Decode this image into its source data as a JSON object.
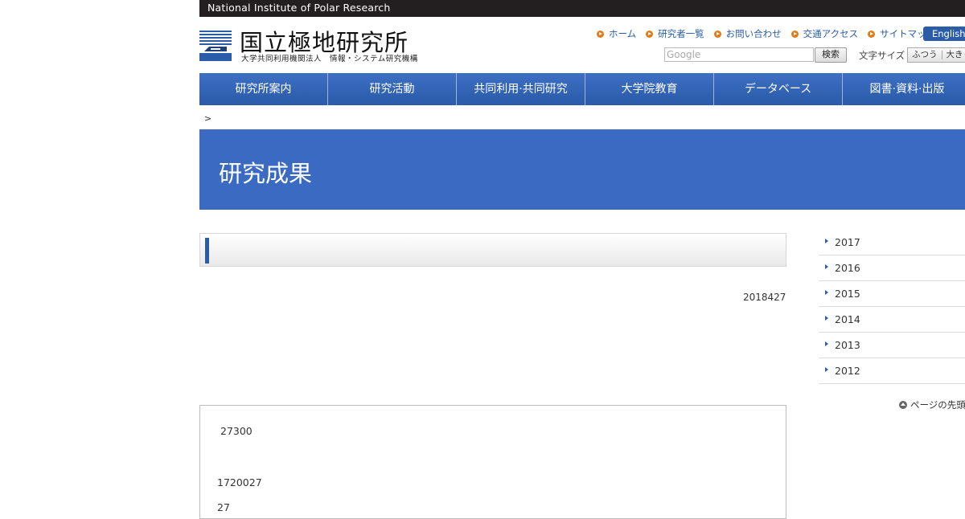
{
  "topbar": {
    "org_name_en": "National Institute of Polar Research"
  },
  "logo": {
    "title": "国立極地研究所",
    "subtitle": "大学共同利用機関法人　情報・システム研究機構"
  },
  "header_nav": {
    "items": [
      {
        "label": "ホーム"
      },
      {
        "label": "研究者一覧"
      },
      {
        "label": "お問い合わせ"
      },
      {
        "label": "交通アクセス"
      },
      {
        "label": "サイトマップ"
      }
    ],
    "english_label": "English"
  },
  "search": {
    "placeholder": "Google",
    "button_label": "検索"
  },
  "font_size": {
    "label": "文字サイズ",
    "normal": "ふつう",
    "large": "大きく"
  },
  "main_nav": {
    "tabs": [
      {
        "label": "研究所案内"
      },
      {
        "label": "研究活動"
      },
      {
        "label": "共同利用·共同研究"
      },
      {
        "label": "大学院教育"
      },
      {
        "label": "データベース"
      },
      {
        "label": "図書·資料·出版"
      }
    ]
  },
  "breadcrumb": {
    "separator": ">"
  },
  "hero": {
    "title": "研究成果"
  },
  "article": {
    "date": "2018427",
    "para1": "27300",
    "para2": "1720027",
    "para3": "27"
  },
  "sidebar": {
    "years": [
      "2017",
      "2016",
      "2015",
      "2014",
      "2013",
      "2012"
    ],
    "page_top_label": "ページの先頭へ"
  },
  "colors": {
    "accent": "#2a5ca8",
    "hero": "#3a6ac2",
    "topbar": "#231f20",
    "bullet": "#e07b16"
  }
}
